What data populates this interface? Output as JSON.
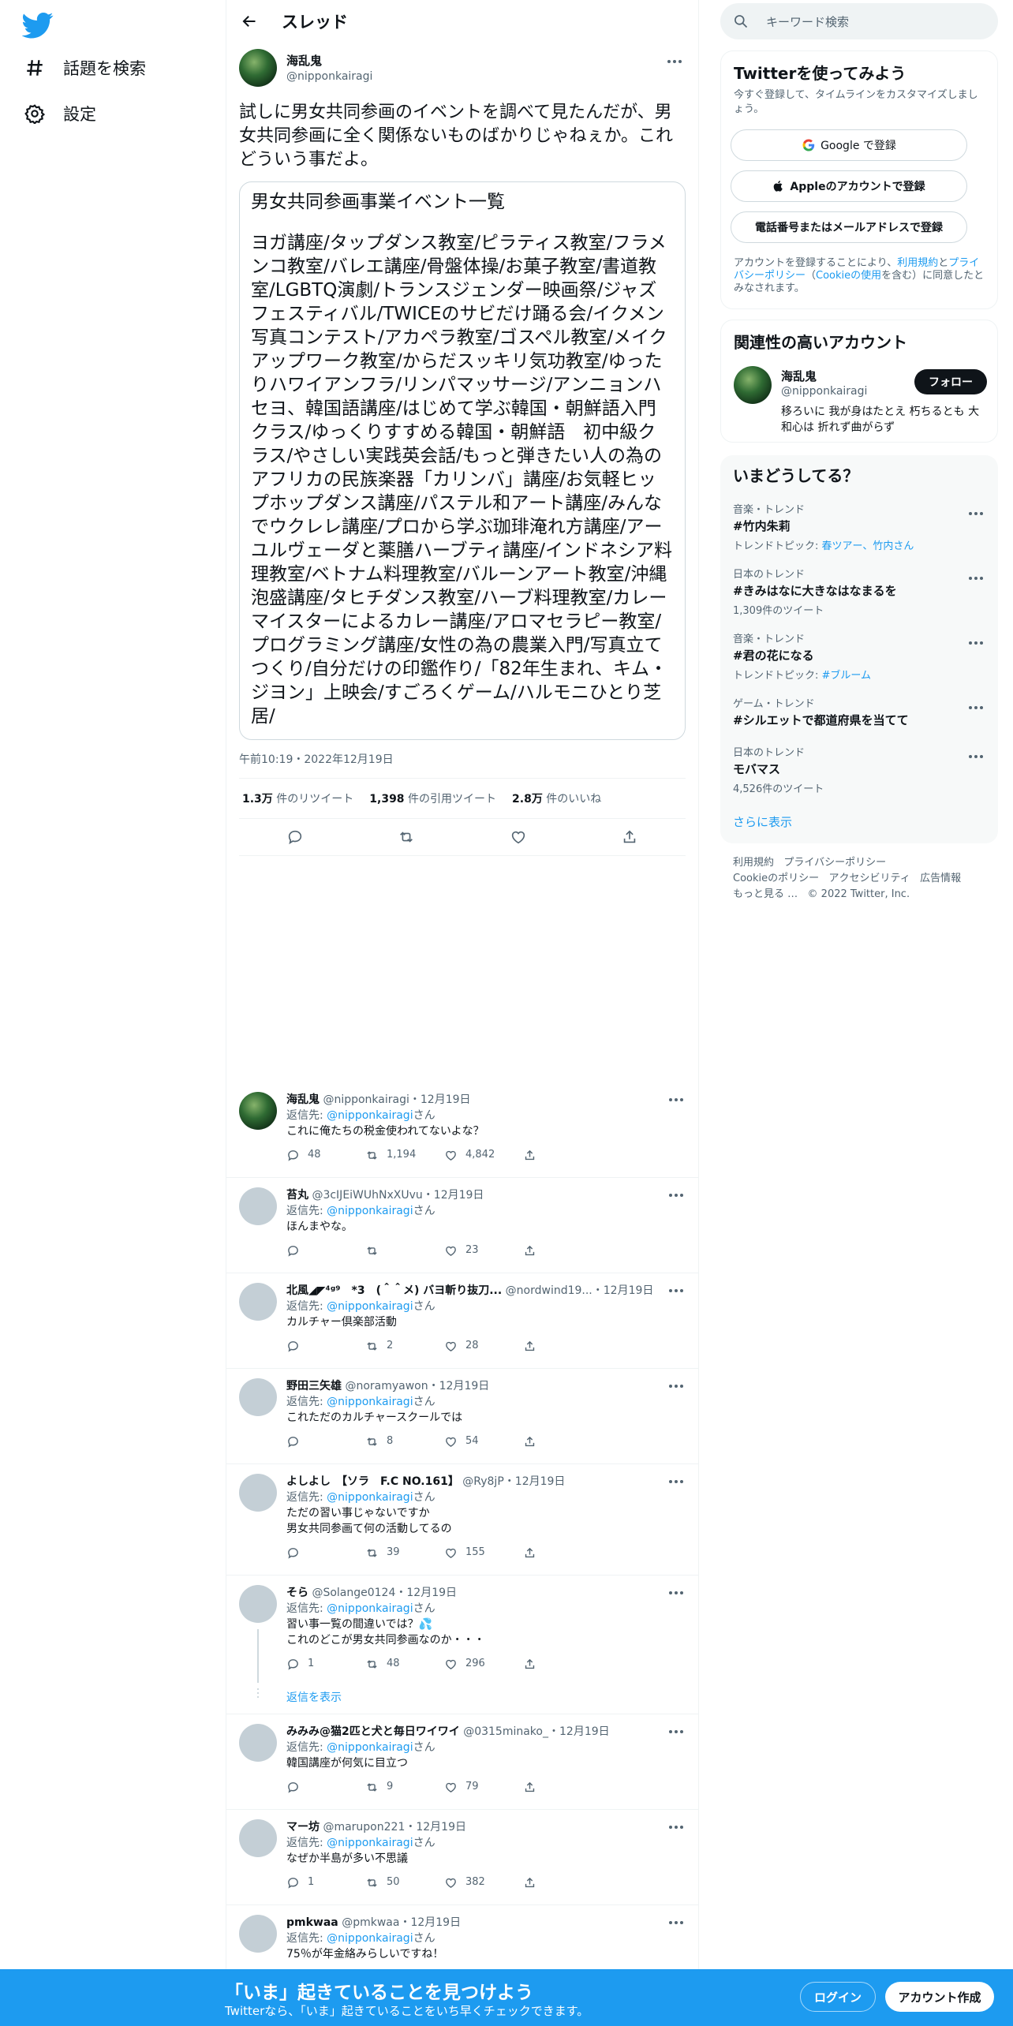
{
  "nav": {
    "items": [
      {
        "label": "話題を検索",
        "icon": "hash-icon"
      },
      {
        "label": "設定",
        "icon": "gear-icon"
      }
    ]
  },
  "header": {
    "title": "スレッド"
  },
  "main_tweet": {
    "name": "海乱鬼",
    "handle": "@nipponkairagi",
    "text": "試しに男女共同参画のイベントを調べて見たんだが、男女共同参画に全く関係ないものばかりじゃねぇか。これどういう事だよ。",
    "card_title": "男女共同参画事業イベント一覧",
    "card_body": "ヨガ講座/タップダンス教室/ピラティス教室/フラメンコ教室/バレエ講座/骨盤体操/お菓子教室/書道教室/LGBTQ演劇/トランスジェンダー映画祭/ジャズフェスティバル/TWICEのサビだけ踊る会/イクメン写真コンテスト/アカペラ教室/ゴスペル教室/メイクアップワーク教室/からだスッキリ気功教室/ゆったりハワイアンフラ/リンパマッサージ/アンニョンハセヨ、韓国語講座/はじめて学ぶ韓国・朝鮮語入門クラス/ゆっくりすすめる韓国・朝鮮語　初中級クラス/やさしい実践英会話/もっと弾きたい人の為のアフリカの民族楽器「カリンバ」講座/お気軽ヒップホップダンス講座/パステル和アート講座/みんなでウクレレ講座/プロから学ぶ珈琲淹れ方講座/アーユルヴェーダと薬膳ハーブティ講座/インドネシア料理教室/ベトナム料理教室/バルーンアート教室/沖縄泡盛講座/タヒチダンス教室/ハーブ料理教室/カレーマイスターによるカレー講座/アロマセラピー教室/プログラミング講座/女性の為の農業入門/写真立てつくり/自分だけの印鑑作り/「82年生まれ、キム・ジヨン」上映会/すごろくゲーム/ハルモニひとり芝居/",
    "timestamp": "午前10:19・2022年12月19日",
    "stats": {
      "retweets": "1.3万",
      "retweets_label": "件のリツイート",
      "quotes": "1,398",
      "quotes_label": "件の引用ツイート",
      "likes": "2.8万",
      "likes_label": "件のいいね"
    }
  },
  "replies": [
    {
      "name": "海乱鬼",
      "handle": "@nipponkairagi",
      "date": "・12月19日",
      "reply_prefix": "返信先: ",
      "reply_to": "@nipponkairagi",
      "reply_suffix": "さん",
      "text": "これに俺たちの税金使われてないよな？",
      "replies": "48",
      "retweets": "1,194",
      "likes": "4,842"
    },
    {
      "name": "苔丸",
      "handle": "@3cIJEiWUhNxXUvu",
      "date": "・12月19日",
      "reply_prefix": "返信先: ",
      "reply_to": "@nipponkairagi",
      "reply_suffix": "さん",
      "text": "ほんまやな。",
      "replies": "",
      "retweets": "",
      "likes": "23"
    },
    {
      "name": "北風◢◤⁴ᵍ⁹　*3　(＾＾メ) バヨ斬り抜刀...",
      "handle": "@nordwind19...",
      "date": "・12月19日",
      "reply_prefix": "返信先: ",
      "reply_to": "@nipponkairagi",
      "reply_suffix": "さん",
      "text": "カルチャー倶楽部活動",
      "replies": "",
      "retweets": "2",
      "likes": "28"
    },
    {
      "name": "野田三矢雄",
      "handle": "@noramyawon",
      "date": "・12月19日",
      "reply_prefix": "返信先: ",
      "reply_to": "@nipponkairagi",
      "reply_suffix": "さん",
      "text": "これただのカルチャースクールでは",
      "replies": "",
      "retweets": "8",
      "likes": "54"
    },
    {
      "name": "よしよし　【ソラ　F.C NO.161】",
      "handle": "@Ry8jP",
      "date": "・12月19日",
      "reply_prefix": "返信先: ",
      "reply_to": "@nipponkairagi",
      "reply_suffix": "さん",
      "text": "ただの習い事じゃないですか\n男女共同参画て何の活動してるの",
      "replies": "",
      "retweets": "39",
      "likes": "155"
    },
    {
      "name": "そら",
      "handle": "@Solange0124",
      "date": "・12月19日",
      "reply_prefix": "返信先: ",
      "reply_to": "@nipponkairagi",
      "reply_suffix": "さん",
      "text": "習い事一覧の間違いでは？💦\nこれのどこが男女共同参画なのか・・・",
      "replies": "1",
      "retweets": "48",
      "likes": "296",
      "show_replies": "返信を表示"
    },
    {
      "name": "みみみ@猫2匹と犬と毎日ワイワイ",
      "handle": "@0315minako_",
      "date": "・12月19日",
      "reply_prefix": "返信先: ",
      "reply_to": "@nipponkairagi",
      "reply_suffix": "さん",
      "text": "韓国講座が何気に目立つ",
      "replies": "",
      "retweets": "9",
      "likes": "79"
    },
    {
      "name": "マー坊",
      "handle": "@marupon221",
      "date": "・12月19日",
      "reply_prefix": "返信先: ",
      "reply_to": "@nipponkairagi",
      "reply_suffix": "さん",
      "text": "なぜか半島が多い不思議",
      "replies": "1",
      "retweets": "50",
      "likes": "382"
    },
    {
      "name": "pmkwaa",
      "handle": "@pmkwaa",
      "date": "・12月19日",
      "reply_prefix": "返信先: ",
      "reply_to": "@nipponkairagi",
      "reply_suffix": "さん",
      "text": "75％が年金絡みらしいですね！",
      "replies": "",
      "retweets": "",
      "likes": ""
    }
  ],
  "right": {
    "search_placeholder": "キーワード検索",
    "signup": {
      "title": "Twitterを使ってみよう",
      "subtitle": "今すぐ登録して、タイムラインをカスタマイズしましょう。",
      "google": "Google で登録",
      "apple": "Appleのアカウントで登録",
      "phone": "電話番号またはメールアドレスで登録",
      "legal_1": "アカウントを登録することにより、",
      "legal_terms": "利用規約",
      "legal_2": "と",
      "legal_privacy": "プライバシーポリシー",
      "legal_3": "（",
      "legal_cookie": "Cookieの使用",
      "legal_4": "を含む）に同意したとみなされます。"
    },
    "related": {
      "title": "関連性の高いアカウント",
      "name": "海乱鬼",
      "handle": "@nipponkairagi",
      "follow": "フォロー",
      "bio": "移ろいに 我が身はたとえ 朽ちるとも 大和心は 折れず曲がらず"
    },
    "trends": {
      "title": "いまどうしてる？",
      "items": [
        {
          "category": "音楽・トレンド",
          "title": "#竹内朱莉",
          "sub_prefix": "トレンドトピック: ",
          "sub_links": "春ツアー、竹内さん"
        },
        {
          "category": "日本のトレンド",
          "title": "#きみはなに大きなはなまるを",
          "sub_prefix": "1,309件のツイート",
          "sub_links": ""
        },
        {
          "category": "音楽・トレンド",
          "title": "#君の花になる",
          "sub_prefix": "トレンドトピック: ",
          "sub_links": "#ブルーム"
        },
        {
          "category": "ゲーム・トレンド",
          "title": "#シルエットで都道府県を当てて",
          "sub_prefix": "",
          "sub_links": ""
        },
        {
          "category": "日本のトレンド",
          "title": "モバマス",
          "sub_prefix": "4,526件のツイート",
          "sub_links": ""
        }
      ],
      "show_more": "さらに表示"
    },
    "footer": {
      "terms": "利用規約",
      "privacy": "プライバシーポリシー",
      "cookie": "Cookieのポリシー",
      "accessibility": "アクセシビリティ",
      "ads": "広告情報",
      "more": "もっと見る …",
      "copyright": "© 2022 Twitter, Inc."
    }
  },
  "bottom_bar": {
    "title": "「いま」起きていることを見つけよう",
    "subtitle": "Twitterなら、「いま」起きていることをいち早くチェックできます。",
    "login": "ログイン",
    "signup": "アカウント作成"
  },
  "colors": {
    "accent": "#1d9bf0",
    "text": "#0f1419",
    "muted": "#536471",
    "border": "#eff3f4"
  }
}
